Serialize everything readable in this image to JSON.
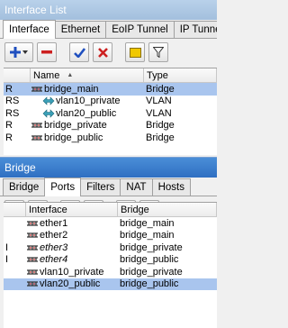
{
  "top_window": {
    "title": "Interface List",
    "tabs": [
      "Interface",
      "Ethernet",
      "EoIP Tunnel",
      "IP Tunnel"
    ],
    "columns": {
      "flags": "",
      "name": "Name",
      "type": "Type"
    },
    "rows": [
      {
        "flags": "R",
        "name": "bridge_main",
        "type": "Bridge",
        "icon": "bridge-icon",
        "indent": false,
        "selected": true
      },
      {
        "flags": "RS",
        "name": "vlan10_private",
        "type": "VLAN",
        "icon": "vlan-icon",
        "indent": true,
        "selected": false
      },
      {
        "flags": "RS",
        "name": "vlan20_public",
        "type": "VLAN",
        "icon": "vlan-icon",
        "indent": true,
        "selected": false
      },
      {
        "flags": "R",
        "name": "bridge_private",
        "type": "Bridge",
        "icon": "bridge-icon",
        "indent": false,
        "selected": false
      },
      {
        "flags": "R",
        "name": "bridge_public",
        "type": "Bridge",
        "icon": "bridge-icon",
        "indent": false,
        "selected": false
      }
    ]
  },
  "bottom_window": {
    "title": "Bridge",
    "tabs": [
      "Bridge",
      "Ports",
      "Filters",
      "NAT",
      "Hosts"
    ],
    "active_tab": 1,
    "columns": {
      "flags": "",
      "interface": "Interface",
      "bridge": "Bridge"
    },
    "rows": [
      {
        "flags": "",
        "interface": "ether1",
        "bridge": "bridge_main",
        "italic": false,
        "selected": false
      },
      {
        "flags": "",
        "interface": "ether2",
        "bridge": "bridge_main",
        "italic": false,
        "selected": false
      },
      {
        "flags": "I",
        "interface": "ether3",
        "bridge": "bridge_private",
        "italic": true,
        "selected": false
      },
      {
        "flags": "I",
        "interface": "ether4",
        "bridge": "bridge_public",
        "italic": true,
        "selected": false
      },
      {
        "flags": "",
        "interface": "vlan10_private",
        "bridge": "bridge_private",
        "italic": false,
        "selected": false
      },
      {
        "flags": "",
        "interface": "vlan20_public",
        "bridge": "bridge_public",
        "italic": false,
        "selected": true
      }
    ]
  },
  "colors": {
    "add": "#1f4fbf",
    "remove": "#cc1f1f",
    "enable": "#1f4fbf",
    "disable": "#cc1f1f",
    "comment": "#f0c800"
  }
}
